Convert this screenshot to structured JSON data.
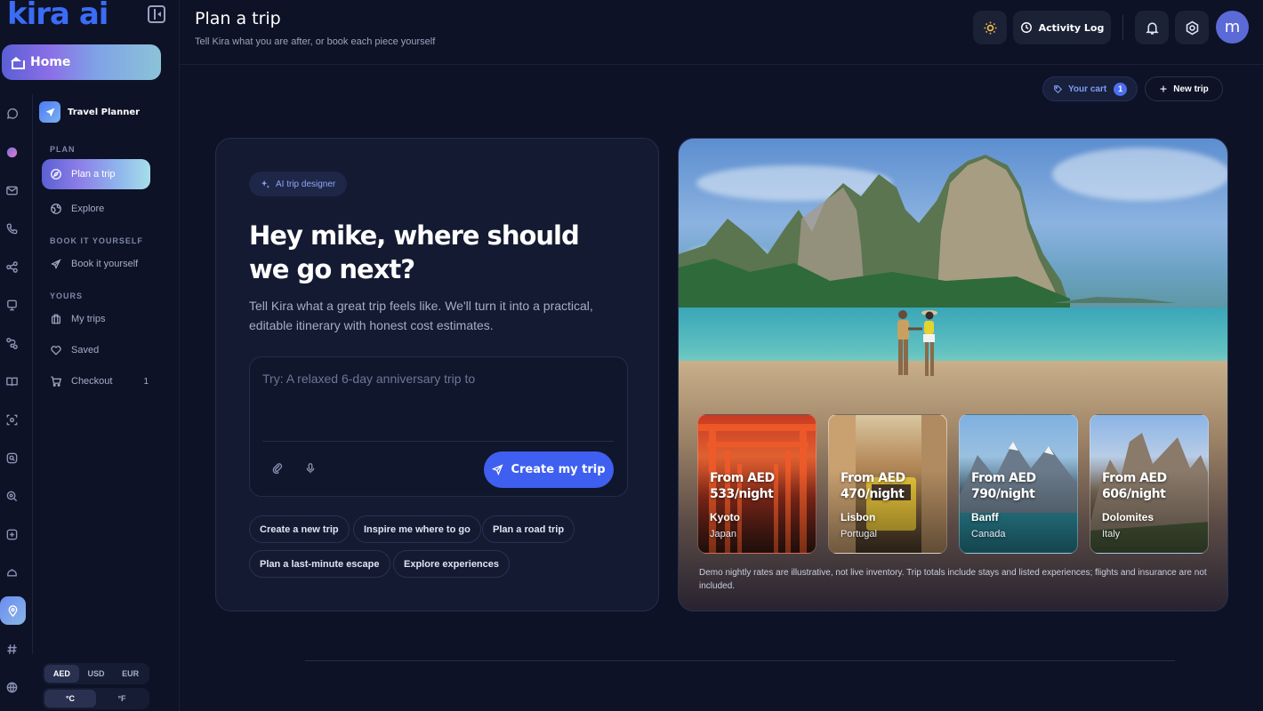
{
  "brand": "kira ai",
  "home_label": "Home",
  "sidebar": {
    "title": "Travel Planner",
    "sections": {
      "plan": "PLAN",
      "book": "BOOK IT YOURSELF",
      "yours": "YOURS"
    },
    "items": [
      {
        "label": "Plan a trip",
        "icon": "compass-icon"
      },
      {
        "label": "Explore",
        "icon": "globe-icon"
      },
      {
        "label": "Book it yourself",
        "icon": "plane-icon"
      },
      {
        "label": "My trips",
        "icon": "suitcase-icon"
      },
      {
        "label": "Saved",
        "icon": "heart-icon"
      },
      {
        "label": "Checkout",
        "icon": "cart-icon",
        "count": "1"
      }
    ],
    "currency": [
      "AED",
      "USD",
      "EUR"
    ],
    "currency_selected": "AED",
    "temperature": [
      "°C",
      "°F"
    ],
    "temperature_selected": "°C"
  },
  "header": {
    "title": "Plan a trip",
    "subtitle": "Tell Kira what you are after, or book each piece yourself",
    "activity_log": "Activity Log",
    "avatar_initial": "m"
  },
  "toolbar": {
    "cart_label": "Your cart",
    "cart_count": "1",
    "new_trip_label": "New trip"
  },
  "planner_card": {
    "pill": "AI trip designer",
    "title": "Hey mike, where should we go next?",
    "description": "Tell Kira what a great trip feels like. We'll turn it into a practical, editable itinerary with honest cost estimates.",
    "prompt_placeholder": "Try: A relaxed 6-day anniversary trip to",
    "create_label": "Create my trip",
    "chips": [
      "Create a new trip",
      "Inspire me where to go",
      "Plan a road trip",
      "Plan a last-minute escape",
      "Explore experiences"
    ]
  },
  "destinations": [
    {
      "price": "From AED 533/night",
      "city": "Kyoto",
      "country": "Japan"
    },
    {
      "price": "From AED 470/night",
      "city": "Lisbon",
      "country": "Portugal"
    },
    {
      "price": "From AED 790/night",
      "city": "Banff",
      "country": "Canada"
    },
    {
      "price": "From AED 606/night",
      "city": "Dolomites",
      "country": "Italy"
    }
  ],
  "disclaimer": "Demo nightly rates are illustrative, not live inventory. Trip totals include stays and listed experiences; flights and insurance are not included.",
  "colors": {
    "background": "#0d1226",
    "accent": "#3f5ff0",
    "card": "#141a32"
  }
}
